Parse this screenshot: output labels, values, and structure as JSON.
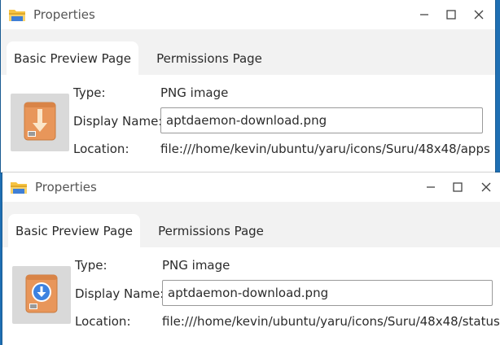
{
  "windows": [
    {
      "title": "Properties",
      "tabs": [
        {
          "label": "Basic Preview Page",
          "active": true
        },
        {
          "label": "Permissions Page",
          "active": false
        }
      ],
      "fields": {
        "type_label": "Type:",
        "type_value": "PNG image",
        "name_label": "Display Name:",
        "name_value": "aptdaemon-download.png",
        "location_label": "Location:",
        "location_value": "file:///home/kevin/ubuntu/yaru/icons/Suru/48x48/apps"
      },
      "preview_icon": "package-download-arrow-icon"
    },
    {
      "title": "Properties",
      "tabs": [
        {
          "label": "Basic Preview Page",
          "active": true
        },
        {
          "label": "Permissions Page",
          "active": false
        }
      ],
      "fields": {
        "type_label": "Type:",
        "type_value": "PNG image",
        "name_label": "Display Name:",
        "name_value": "aptdaemon-download.png",
        "location_label": "Location:",
        "location_value": "file:///home/kevin/ubuntu/yaru/icons/Suru/48x48/status"
      },
      "preview_icon": "package-download-badge-icon"
    }
  ],
  "window_controls": [
    "minimize-icon",
    "maximize-icon",
    "close-icon"
  ],
  "colors": {
    "folder_yellow": "#f6c342",
    "folder_blue": "#3f7fd6",
    "package_orange": "#e8965a",
    "badge_blue": "#3d82e0",
    "desktop_blue": "#1f6fb3"
  }
}
